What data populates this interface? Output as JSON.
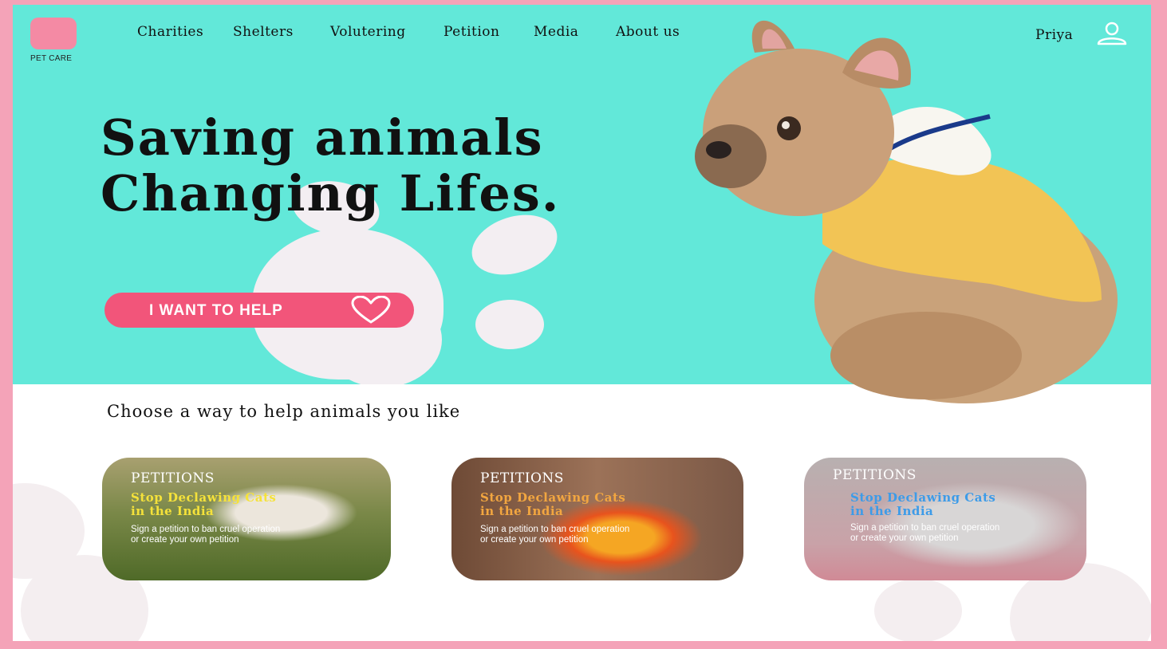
{
  "brand": {
    "name": "PET CARE",
    "color": "#f48aa4"
  },
  "nav": {
    "items": [
      "Charities",
      "Shelters",
      "Volutering",
      "Petition",
      "Media",
      "About us"
    ]
  },
  "user": {
    "name": "Priya",
    "icon": "user-icon"
  },
  "hero": {
    "headline_line1": "Saving animals",
    "headline_line2": "Changing Lifes.",
    "cta_label": "I  WANT TO HELP",
    "cta_icon": "heart-icon",
    "background_color": "#62e8d9",
    "cta_color": "#f2557a"
  },
  "section": {
    "title": "Choose a way to help animals you like"
  },
  "cards": [
    {
      "tag": "PETITIONS",
      "title_line1": "Stop Declawing Cats",
      "title_line2": "in the India",
      "desc": "Sign a petition to ban cruel operation or create your own petition",
      "title_color": "#f5e23a"
    },
    {
      "tag": "PETITIONS",
      "title_line1": "Stop Declawing Cats",
      "title_line2": "in the India",
      "desc": "Sign a petition to ban cruel operation or create your own petition",
      "title_color": "#f2a640"
    },
    {
      "tag": "PETITIONS",
      "title_line1": "Stop Declawing Cats",
      "title_line2": "in the India",
      "desc": "Sign a petition to ban cruel operation or create your own petition",
      "title_color": "#3d9be8"
    }
  ]
}
